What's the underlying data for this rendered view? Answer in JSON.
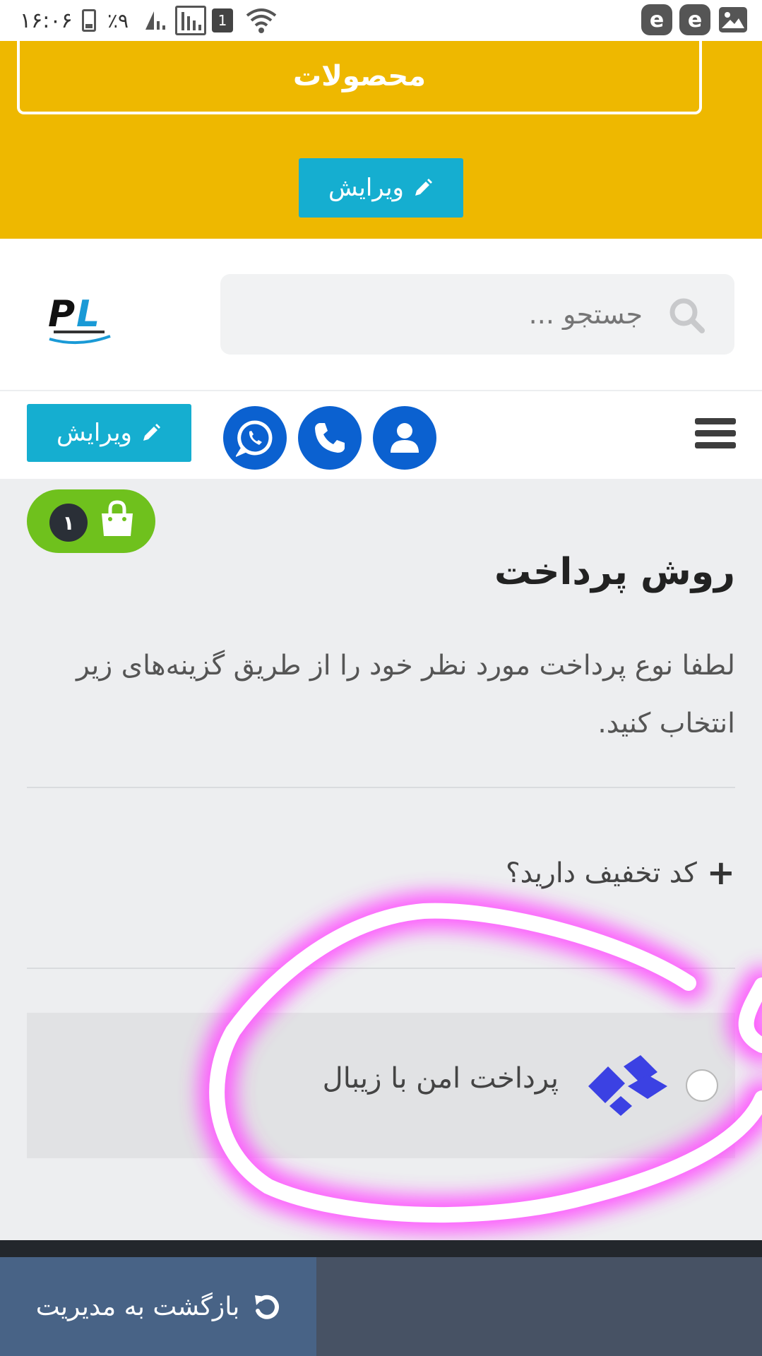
{
  "status_bar": {
    "time": "۱۶:۰۶",
    "battery": "٪۹",
    "sim": "1",
    "icons": [
      "battery-icon",
      "signal-icon",
      "signal-icon",
      "sim-icon",
      "wifi-icon",
      "eitaa-app-icon",
      "eitaa-app-icon",
      "gallery-icon"
    ]
  },
  "header": {
    "products_label": "محصولات",
    "edit_label": "ویرایش"
  },
  "search": {
    "placeholder": "جستجو ..."
  },
  "logo": {
    "text": "PL"
  },
  "nav": {
    "edit_label": "ویرایش",
    "icons": [
      "user-icon",
      "phone-icon",
      "whatsapp-icon",
      "menu-icon"
    ]
  },
  "cart": {
    "count": "۱"
  },
  "payment": {
    "title": "روش پرداخت",
    "description": "لطفا نوع پرداخت مورد نظر خود را از طریق گزینه‌های زیر انتخاب کنید.",
    "coupon_label": "کد تخفیف دارید؟",
    "gateway_label": "پرداخت امن با زیبال",
    "gateway_selected": false
  },
  "footer": {
    "back_label": "بازگشت به مدیریت"
  },
  "colors": {
    "banner": "#eeb800",
    "edit_button": "#15aed0",
    "nav_circle": "#0b61d0",
    "cart_badge": "#6fc11d",
    "zibal": "#3b41e3",
    "annotation": "#ff4dff",
    "footer": "#475264",
    "back_button": "#486386"
  }
}
